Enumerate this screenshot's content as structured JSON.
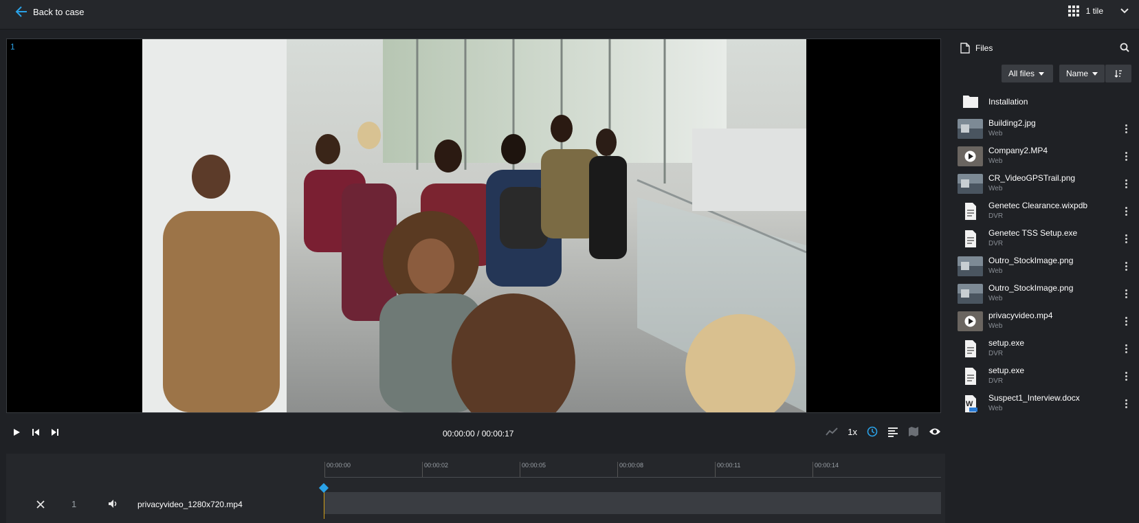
{
  "topbar": {
    "back_label": "Back to case",
    "tile_label": "1 tile"
  },
  "viewer": {
    "tile_number": "1"
  },
  "controls": {
    "time": "00:00:00 / 00:00:17",
    "speed": "1x"
  },
  "timeline": {
    "ticks": [
      "00:00:00",
      "00:00:02",
      "00:00:05",
      "00:00:08",
      "00:00:11",
      "00:00:14"
    ],
    "track": {
      "number": "1",
      "name": "privacyvideo_1280x720.mp4"
    }
  },
  "panel": {
    "title": "Files",
    "filter_label": "All files",
    "sort_label": "Name",
    "files": [
      {
        "name": "Installation",
        "sub": "",
        "kind": "folder"
      },
      {
        "name": "Building2.jpg",
        "sub": "Web",
        "kind": "image"
      },
      {
        "name": "Company2.MP4",
        "sub": "Web",
        "kind": "video"
      },
      {
        "name": "CR_VideoGPSTrail.png",
        "sub": "Web",
        "kind": "image"
      },
      {
        "name": "Genetec Clearance.wixpdb",
        "sub": "DVR",
        "kind": "doc"
      },
      {
        "name": "Genetec TSS Setup.exe",
        "sub": "DVR",
        "kind": "doc"
      },
      {
        "name": "Outro_StockImage.png",
        "sub": "Web",
        "kind": "image"
      },
      {
        "name": "Outro_StockImage.png",
        "sub": "Web",
        "kind": "image"
      },
      {
        "name": "privacyvideo.mp4",
        "sub": "Web",
        "kind": "video"
      },
      {
        "name": "setup.exe",
        "sub": "DVR",
        "kind": "doc"
      },
      {
        "name": "setup.exe",
        "sub": "DVR",
        "kind": "doc"
      },
      {
        "name": "Suspect1_Interview.docx",
        "sub": "Web",
        "kind": "word"
      }
    ]
  },
  "colors": {
    "accent": "#2aa2e8",
    "playhead": "#d4a017"
  }
}
